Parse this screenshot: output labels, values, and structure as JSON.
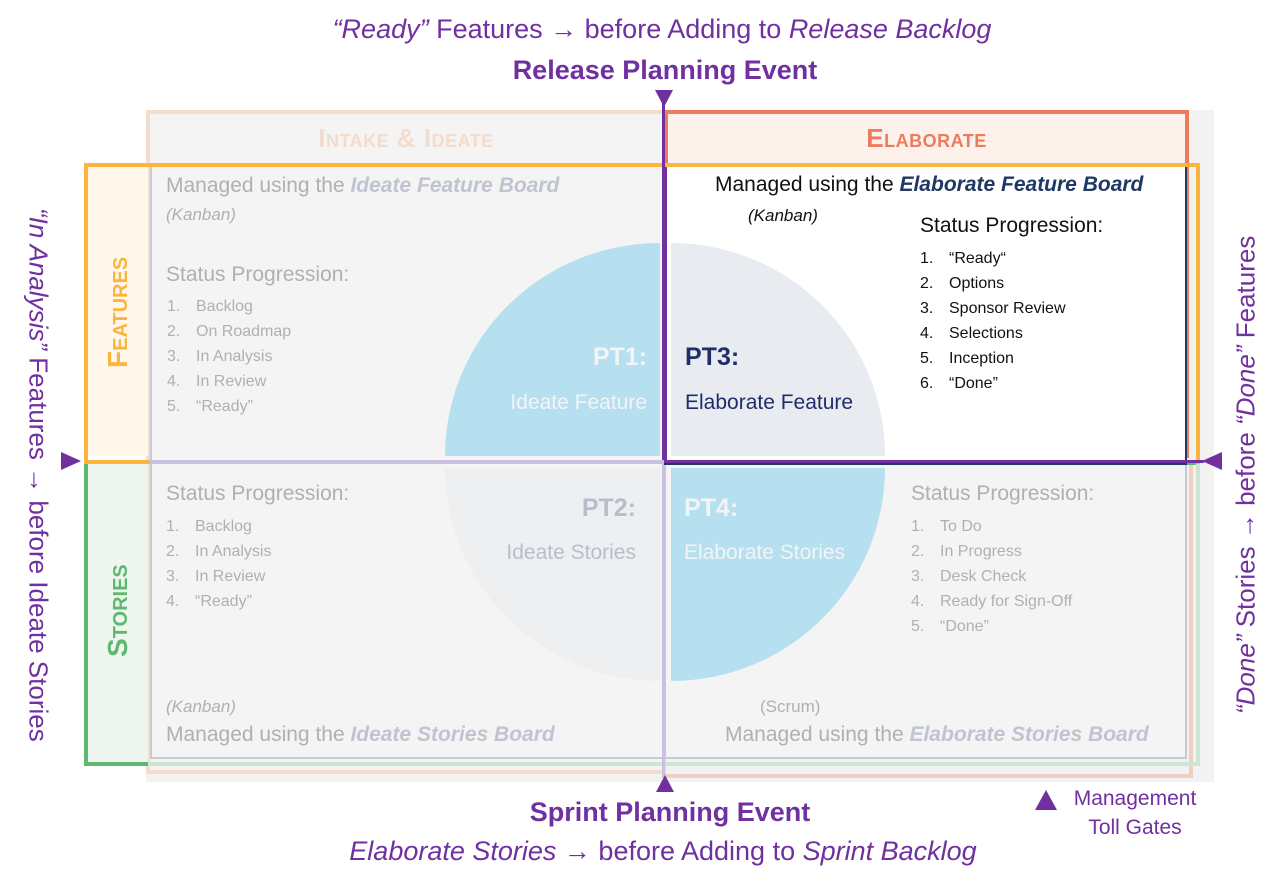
{
  "header": {
    "caption_quote": "“Ready”",
    "caption_mid": " Features → before Adding to ",
    "caption_end": "Release Backlog",
    "event": "Release Planning Event"
  },
  "footer": {
    "event": "Sprint Planning Event",
    "caption_start": "Elaborate Stories",
    "caption_mid": " → before Adding to ",
    "caption_end": "Sprint Backlog"
  },
  "legend": {
    "icon": "triangle-up",
    "line1": "Management",
    "line2": "Toll Gates"
  },
  "left_side": {
    "quote": "“In Analysis”",
    "rest": " Features → before Ideate Stories"
  },
  "right_side": {
    "quote_done_stories": "“Done”",
    "mid": " Stories → before ",
    "quote_done_features": "“Done”",
    "end": " Features"
  },
  "columns": {
    "intake": "Intake & Ideate",
    "elaborate": "Elaborate"
  },
  "rows": {
    "features": "Features",
    "stories": "Stories"
  },
  "colors": {
    "purple": "#7030a0",
    "intake": "#f3dccc",
    "elaborate": "#ec7c5c",
    "features": "#fbb53c",
    "stories": "#5eb970",
    "navy": "#1f3864",
    "active_blue": "#b6e0f0"
  },
  "quadrants": {
    "pt1": {
      "code": "PT1:",
      "name": "Ideate Feature",
      "managed_prefix": "Managed using the ",
      "board": "Ideate Feature Board",
      "method": "(Kanban)",
      "status_title": "Status Progression:",
      "statuses": [
        "Backlog",
        "On Roadmap",
        "In Analysis",
        "In Review",
        "“Ready”"
      ]
    },
    "pt3": {
      "code": "PT3:",
      "name": "Elaborate Feature",
      "managed_prefix": "Managed using the ",
      "board": "Elaborate Feature Board",
      "method": "(Kanban)",
      "status_title": "Status Progression:",
      "statuses": [
        "“Ready“",
        "Options",
        "Sponsor Review",
        "Selections",
        "Inception",
        "“Done”"
      ]
    },
    "pt2": {
      "code": "PT2:",
      "name": "Ideate Stories",
      "managed_prefix": "Managed using the ",
      "board": "Ideate Stories Board",
      "method": "(Kanban)",
      "status_title": "Status Progression:",
      "statuses": [
        "Backlog",
        "In Analysis",
        "In Review",
        "“Ready”"
      ]
    },
    "pt4": {
      "code": "PT4:",
      "name": "Elaborate Stories",
      "managed_prefix": "Managed using the ",
      "board": "Elaborate Stories Board",
      "method": "(Scrum)",
      "status_title": "Status Progression:",
      "statuses": [
        "To Do",
        "In Progress",
        "Desk Check",
        "Ready for Sign-Off",
        "“Done”"
      ]
    }
  }
}
